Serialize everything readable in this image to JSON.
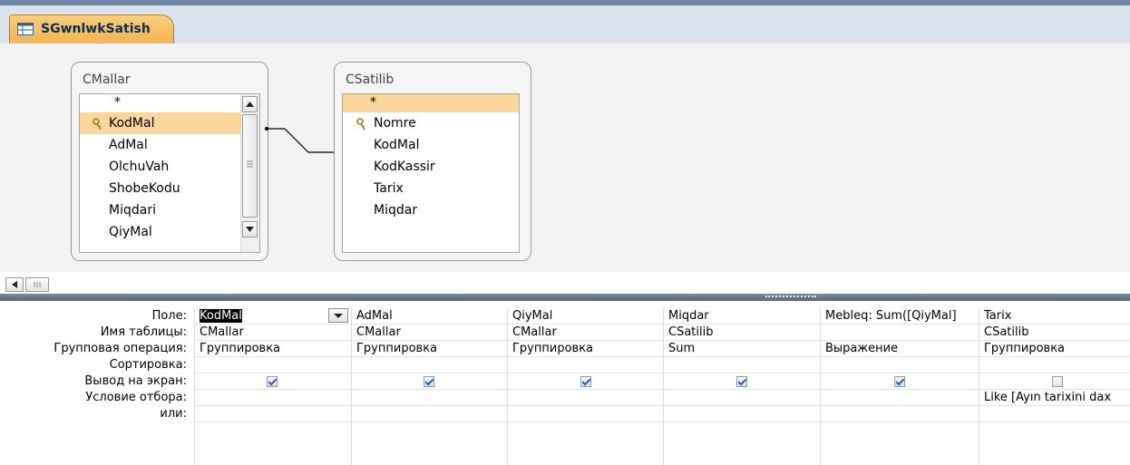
{
  "tab": {
    "title": "SGwnlwkSatish"
  },
  "tables": [
    {
      "name": "CMallar",
      "fields": [
        "*",
        "KodMal",
        "AdMal",
        "OlchuVah",
        "ShobeKodu",
        "Miqdari",
        "QiyMal"
      ]
    },
    {
      "name": "CSatilib",
      "fields": [
        "*",
        "Nomre",
        "KodMal",
        "KodKassir",
        "Tarix",
        "Miqdar"
      ]
    }
  ],
  "row_labels": [
    "Поле:",
    "Имя таблицы:",
    "Групповая операция:",
    "Сортировка:",
    "Вывод на экран:",
    "Условие отбора:",
    "или:"
  ],
  "columns": [
    {
      "field": "KodMal",
      "table": "CMallar",
      "total": "Группировка",
      "sort": "",
      "show": true,
      "criteria": "",
      "or": ""
    },
    {
      "field": "AdMal",
      "table": "CMallar",
      "total": "Группировка",
      "sort": "",
      "show": true,
      "criteria": "",
      "or": ""
    },
    {
      "field": "QiyMal",
      "table": "CMallar",
      "total": "Группировка",
      "sort": "",
      "show": true,
      "criteria": "",
      "or": ""
    },
    {
      "field": "Miqdar",
      "table": "CSatilib",
      "total": "Sum",
      "sort": "",
      "show": true,
      "criteria": "",
      "or": ""
    },
    {
      "field": "Mebleq: Sum([QiyMal]",
      "table": "",
      "total": "Выражение",
      "sort": "",
      "show": true,
      "criteria": "",
      "or": ""
    },
    {
      "field": "Tarix",
      "table": "CSatilib",
      "total": "Группировка",
      "sort": "",
      "show": false,
      "criteria": "Like [Ayın tarixini dax",
      "or": ""
    }
  ],
  "colors": {
    "tab_bg": "#f3b14f",
    "selected_field": "#fbd69d",
    "splitter": "#6a7588"
  }
}
